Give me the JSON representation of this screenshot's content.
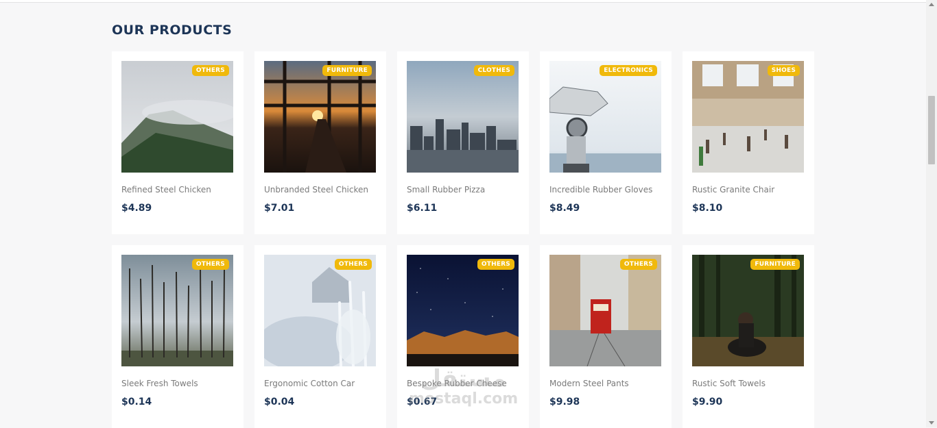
{
  "section": {
    "title": "OUR PRODUCTS"
  },
  "colors": {
    "badge": "#f0b90b",
    "heading": "#1d3557",
    "price": "#1d3557"
  },
  "watermark": {
    "arabic": "مستقل",
    "latin": "mostaql.com"
  },
  "products": [
    {
      "name": "Refined Steel Chicken",
      "price": "$4.89",
      "category": "OTHERS",
      "image": "misty-mountain-image"
    },
    {
      "name": "Unbranded Steel Chicken",
      "price": "$7.01",
      "category": "FURNITURE",
      "image": "sunset-highway-image"
    },
    {
      "name": "Small Rubber Pizza",
      "price": "$6.11",
      "category": "CLOTHES",
      "image": "city-skyline-image"
    },
    {
      "name": "Incredible Rubber Gloves",
      "price": "$8.49",
      "category": "ELECTRONICS",
      "image": "binocular-viewer-image"
    },
    {
      "name": "Rustic Granite Chair",
      "price": "$8.10",
      "category": "SHOES",
      "image": "train-station-image"
    },
    {
      "name": "Sleek Fresh Towels",
      "price": "$0.14",
      "category": "OTHERS",
      "image": "bare-trees-image"
    },
    {
      "name": "Ergonomic Cotton Car",
      "price": "$0.04",
      "category": "OTHERS",
      "image": "frosted-plants-image"
    },
    {
      "name": "Bespoke Rubber Cheese",
      "price": "$0.67",
      "category": "OTHERS",
      "image": "night-sky-image"
    },
    {
      "name": "Modern Steel Pants",
      "price": "$9.98",
      "category": "OTHERS",
      "image": "red-tram-street-image"
    },
    {
      "name": "Rustic Soft Towels",
      "price": "$9.90",
      "category": "FURNITURE",
      "image": "forest-reader-image"
    }
  ]
}
